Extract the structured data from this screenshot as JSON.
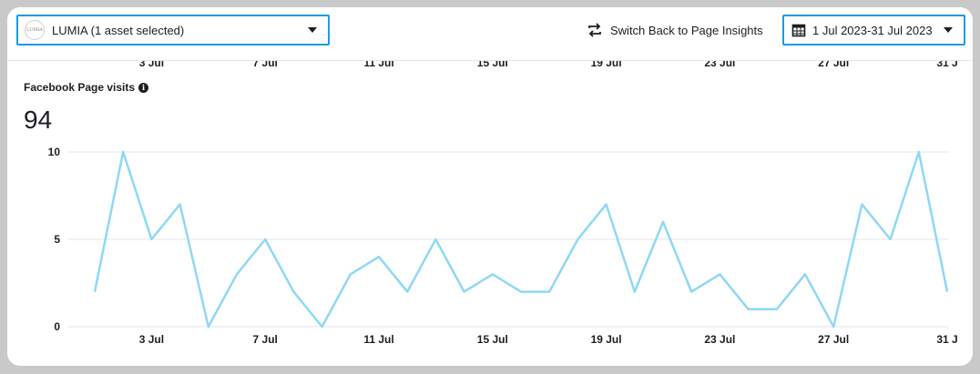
{
  "toolbar": {
    "asset_label": "LUMIA (1 asset selected)",
    "asset_logo_text": "LUMIA",
    "switch_label": "Switch Back to Page Insights",
    "date_range": "1 Jul 2023-31 Jul 2023"
  },
  "metric": {
    "title": "Facebook Page visits",
    "total": "94"
  },
  "colors": {
    "accent": "#1a9be6",
    "line": "#8fd8f5",
    "grid": "#e4e6eb"
  },
  "chart_data": {
    "type": "line",
    "x": [
      "1 Jul",
      "2 Jul",
      "3 Jul",
      "4 Jul",
      "5 Jul",
      "6 Jul",
      "7 Jul",
      "8 Jul",
      "9 Jul",
      "10 Jul",
      "11 Jul",
      "12 Jul",
      "13 Jul",
      "14 Jul",
      "15 Jul",
      "16 Jul",
      "17 Jul",
      "18 Jul",
      "19 Jul",
      "20 Jul",
      "21 Jul",
      "22 Jul",
      "23 Jul",
      "24 Jul",
      "25 Jul",
      "26 Jul",
      "27 Jul",
      "28 Jul",
      "29 Jul",
      "30 Jul",
      "31 Jul"
    ],
    "values": [
      2,
      10,
      5,
      7,
      0,
      3,
      5,
      2,
      0,
      3,
      4,
      2,
      5,
      2,
      3,
      2,
      2,
      5,
      7,
      2,
      6,
      2,
      3,
      1,
      1,
      3,
      0,
      7,
      5,
      10,
      2
    ],
    "ylim": [
      0,
      10
    ],
    "yticks": [
      "0",
      "5",
      "10"
    ],
    "xtick_indices": [
      2,
      6,
      10,
      14,
      18,
      22,
      26,
      30
    ],
    "xtick_labels": [
      "3 Jul",
      "7 Jul",
      "11 Jul",
      "15 Jul",
      "19 Jul",
      "23 Jul",
      "27 Jul",
      "31 J"
    ],
    "grid": true
  }
}
